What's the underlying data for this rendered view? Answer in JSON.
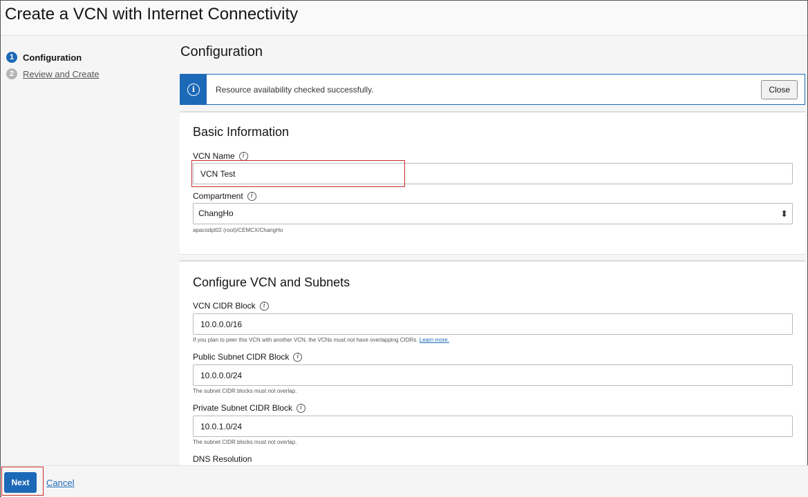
{
  "window": {
    "title": "Create a VCN with Internet Connectivity"
  },
  "steps": [
    {
      "number": "1",
      "label": "Configuration",
      "state": "active"
    },
    {
      "number": "2",
      "label": "Review and Create",
      "state": "pending"
    }
  ],
  "main": {
    "title": "Configuration",
    "alert": {
      "icon": "info-icon",
      "message": "Resource availability checked successfully.",
      "close_label": "Close"
    },
    "basic_info": {
      "title": "Basic Information",
      "vcn_name": {
        "label": "VCN Name",
        "value": "VCN Test"
      },
      "compartment": {
        "label": "Compartment",
        "value": "ChangHo",
        "path": "apacodpt02 (root)/CEMCX/ChangHo"
      }
    },
    "vcn_subnets": {
      "title": "Configure VCN and Subnets",
      "vcn_cidr": {
        "label": "VCN CIDR Block",
        "value": "10.0.0.0/16",
        "hint": "If you plan to peer this VCN with another VCN, the VCNs must not have overlapping CIDRs.",
        "hint_link": "Learn more."
      },
      "public_subnet": {
        "label": "Public Subnet CIDR Block",
        "value": "10.0.0.0/24",
        "hint": "The subnet CIDR blocks must not overlap."
      },
      "private_subnet": {
        "label": "Private Subnet CIDR Block",
        "value": "10.0.1.0/24",
        "hint": "The subnet CIDR blocks must not overlap."
      },
      "dns_label": "DNS Resolution"
    }
  },
  "footer": {
    "next_label": "Next",
    "cancel_label": "Cancel"
  },
  "colors": {
    "primary": "#1c69b8",
    "highlight": "#c92a2a"
  }
}
